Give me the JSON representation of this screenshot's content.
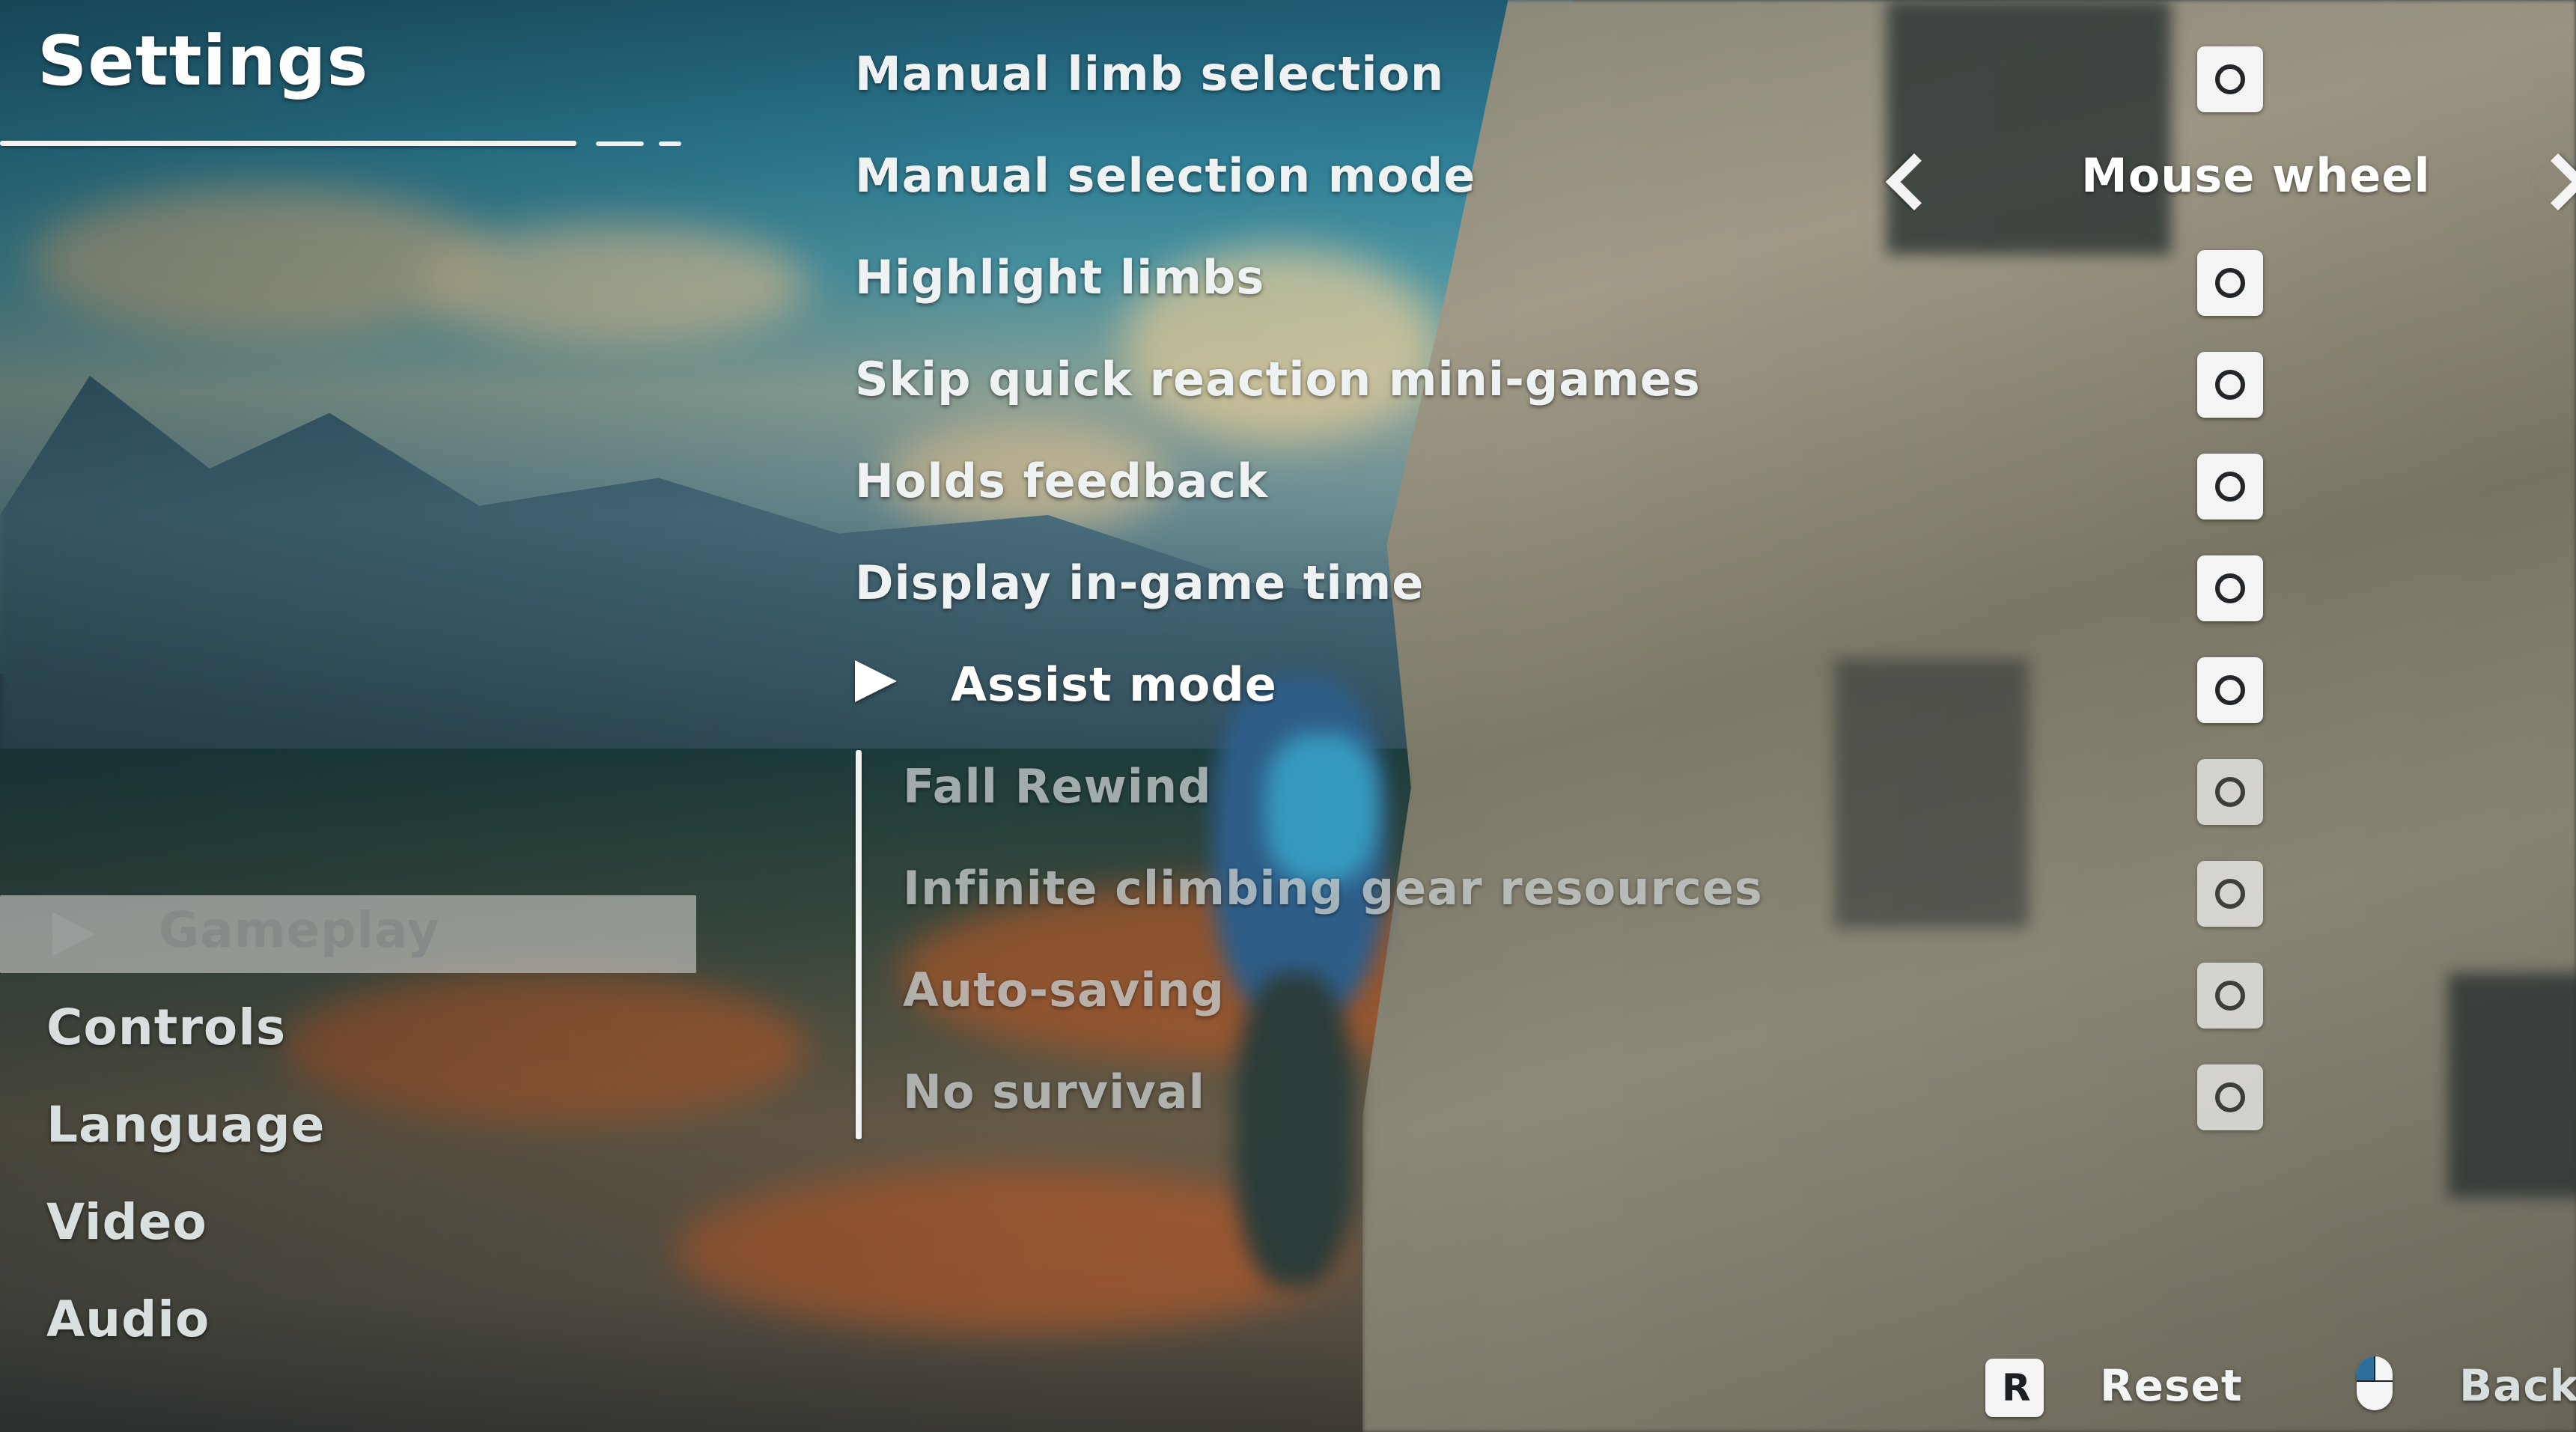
{
  "header": {
    "title": "Settings"
  },
  "categories": [
    {
      "label": "Gameplay",
      "active": true
    },
    {
      "label": "Controls",
      "active": false
    },
    {
      "label": "Language",
      "active": false
    },
    {
      "label": "Video",
      "active": false
    },
    {
      "label": "Audio",
      "active": false
    }
  ],
  "settings": [
    {
      "label": "Manual limb selection",
      "control": "toggle"
    },
    {
      "label": "Manual selection mode",
      "control": "selector",
      "value": "Mouse wheel"
    },
    {
      "label": "Highlight limbs",
      "control": "toggle"
    },
    {
      "label": "Skip quick reaction mini-games",
      "control": "toggle"
    },
    {
      "label": "Holds feedback",
      "control": "toggle"
    },
    {
      "label": "Display in-game time",
      "control": "toggle"
    },
    {
      "label": "Assist mode",
      "control": "toggle",
      "selected": true
    },
    {
      "label": "Fall Rewind",
      "control": "toggle",
      "sub": true
    },
    {
      "label": "Infinite climbing gear resources",
      "control": "toggle",
      "sub": true
    },
    {
      "label": "Auto-saving",
      "control": "toggle",
      "sub": true
    },
    {
      "label": "No survival",
      "control": "toggle",
      "sub": true
    }
  ],
  "footer": {
    "reset_key": "R",
    "reset_label": "Reset",
    "back_icon": "mouse-left-click-icon",
    "back_label": "Back"
  },
  "colors": {
    "text": "#eef2f3",
    "toggle": "#f3f4f3",
    "active_category_bg": "#cdcdc8",
    "mouse_button_accent": "#2d6f9a"
  }
}
